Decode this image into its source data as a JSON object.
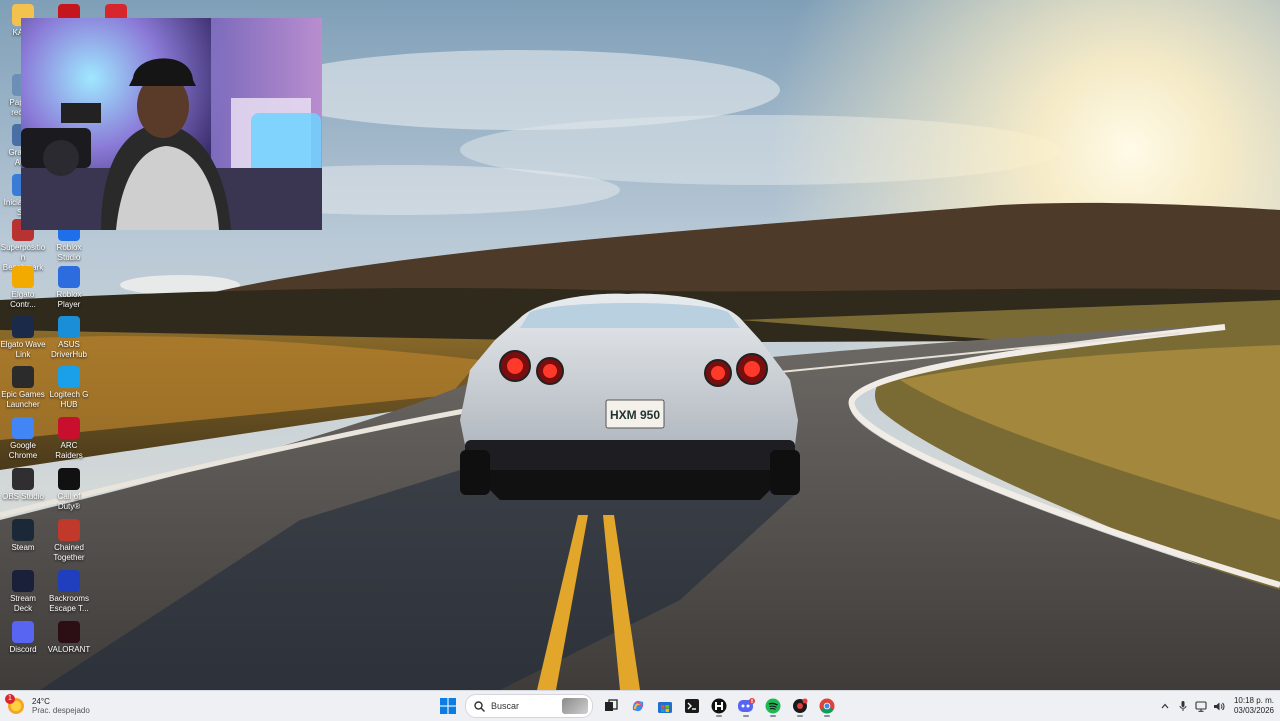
{
  "desktop": {
    "icons": [
      {
        "label": "KAT...",
        "icon": "folder-icon",
        "color": "#f2c14e"
      },
      {
        "label": "",
        "icon": "acrobat-icon",
        "color": "#c4161c"
      },
      {
        "label": "",
        "icon": "app-red-icon",
        "color": "#d7262e"
      },
      {
        "label": "Papel... recic...",
        "icon": "recycle-bin-icon",
        "color": "#6b8fb5"
      },
      {
        "label": "Graba... Au...",
        "icon": "audio-recorder-icon",
        "color": "#4a6fa5"
      },
      {
        "label": "Iniciar... en S...",
        "icon": "shortcut-icon",
        "color": "#3a7bd5"
      },
      {
        "label": "Superposition Benchmark",
        "icon": "benchmark-icon",
        "color": "#b83232"
      },
      {
        "label": "Roblox Studio",
        "icon": "roblox-studio-icon",
        "color": "#1f6feb"
      },
      {
        "label": "Elgato Contr...",
        "icon": "elgato-control-icon",
        "color": "#f2a900"
      },
      {
        "label": "Roblox Player",
        "icon": "roblox-player-icon",
        "color": "#2d6cdf"
      },
      {
        "label": "Elgato Wave Link",
        "icon": "elgato-wave-icon",
        "color": "#1c2a4a"
      },
      {
        "label": "ASUS DriverHub",
        "icon": "asus-driverhub-icon",
        "color": "#1a8fd8"
      },
      {
        "label": "Epic Games Launcher",
        "icon": "epic-games-icon",
        "color": "#2b2b2b"
      },
      {
        "label": "Logitech G HUB",
        "icon": "logitech-ghub-icon",
        "color": "#1aa0e8"
      },
      {
        "label": "Google Chrome",
        "icon": "chrome-icon",
        "color": "#4285f4"
      },
      {
        "label": "ARC Raiders",
        "icon": "arc-raiders-icon",
        "color": "#c8102e"
      },
      {
        "label": "OBS Studio",
        "icon": "obs-icon",
        "color": "#302e31"
      },
      {
        "label": "Call of Duty®",
        "icon": "call-of-duty-icon",
        "color": "#111111"
      },
      {
        "label": "Steam",
        "icon": "steam-icon",
        "color": "#1b2838"
      },
      {
        "label": "Chained Together",
        "icon": "chained-together-icon",
        "color": "#c0392b"
      },
      {
        "label": "Stream Deck",
        "icon": "stream-deck-icon",
        "color": "#1a1f3a"
      },
      {
        "label": "Backrooms Escape T...",
        "icon": "backrooms-icon",
        "color": "#1f3fbf"
      },
      {
        "label": "Discord",
        "icon": "discord-icon",
        "color": "#5865f2"
      },
      {
        "label": "VALORANT",
        "icon": "valorant-icon",
        "color": "#2b0f14"
      }
    ]
  },
  "wallpaper": {
    "license_plate": "HXM 950"
  },
  "taskbar": {
    "weather": {
      "temp": "24°C",
      "condition": "Prac. despejado",
      "badge": "1"
    },
    "search": {
      "placeholder": "Buscar"
    },
    "apps": [
      {
        "name": "start-button",
        "icon": "windows-logo-icon"
      },
      {
        "name": "task-view",
        "icon": "task-view-icon"
      },
      {
        "name": "copilot",
        "icon": "copilot-icon"
      },
      {
        "name": "store",
        "icon": "store-icon"
      },
      {
        "name": "terminal",
        "icon": "terminal-icon"
      },
      {
        "name": "app-h",
        "icon": "h-app-icon"
      },
      {
        "name": "discord",
        "icon": "discord-icon",
        "badge": "8"
      },
      {
        "name": "spotify",
        "icon": "spotify-icon"
      },
      {
        "name": "app-red-black",
        "icon": "app-badge-icon"
      },
      {
        "name": "chrome",
        "icon": "chrome-icon"
      }
    ],
    "clock": {
      "time": "10:18 p. m.",
      "date": "03/03/2026"
    }
  }
}
